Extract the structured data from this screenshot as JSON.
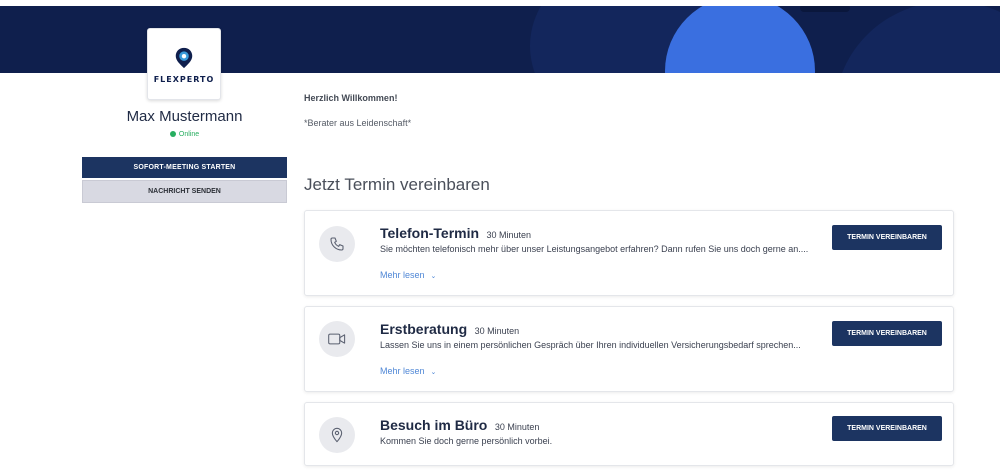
{
  "logo": {
    "text": "FLEXPERTO"
  },
  "profile": {
    "name": "Max Mustermann",
    "status": "Online",
    "meeting_button": "SOFORT-MEETING STARTEN",
    "message_button": "NACHRICHT SENDEN"
  },
  "main": {
    "welcome": "Herzlich Willkommen!",
    "tagline": "*Berater aus Leidenschaft*",
    "section_title": "Jetzt Termin vereinbaren"
  },
  "appointments": [
    {
      "icon": "phone-icon",
      "title": "Telefon-Termin",
      "duration": "30 Minuten",
      "description": "Sie möchten telefonisch mehr über unser Leistungsangebot erfahren? Dann rufen Sie uns doch gerne an....",
      "more": "Mehr lesen",
      "button": "TERMIN VEREINBAREN"
    },
    {
      "icon": "video-icon",
      "title": "Erstberatung",
      "duration": "30 Minuten",
      "description": "Lassen Sie uns in einem persönlichen Gespräch über Ihren individuellen Versicherungsbedarf sprechen...",
      "more": "Mehr lesen",
      "button": "TERMIN VEREINBAREN"
    },
    {
      "icon": "location-pin-icon",
      "title": "Besuch im Büro",
      "duration": "30 Minuten",
      "description": "Kommen Sie doch gerne persönlich vorbei.",
      "button": "TERMIN VEREINBAREN"
    }
  ],
  "colors": {
    "banner": "#0f1f4d",
    "accent_blue": "#3a6fe0",
    "primary_button": "#1c3461",
    "online": "#27ae60",
    "link": "#4f87d6"
  }
}
